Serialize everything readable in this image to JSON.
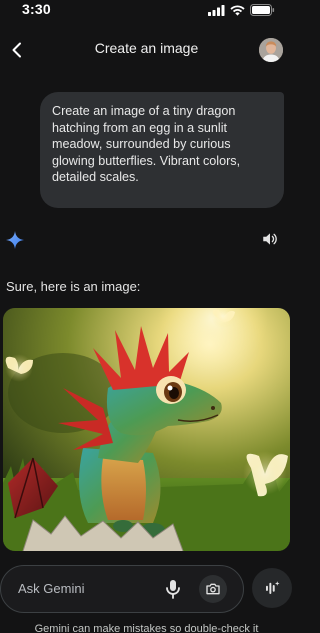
{
  "status_bar": {
    "time": "3:30",
    "icons": [
      "signal-icon",
      "wifi-icon",
      "battery-icon"
    ]
  },
  "header": {
    "back_icon": "back-arrow-icon",
    "title": "Create an image",
    "avatar": "user-avatar"
  },
  "chat": {
    "user_prompt": "Create an image of a tiny dragon hatching from an egg in a sunlit meadow, surrounded by curious glowing butterflies. Vibrant colors, detailed scales.",
    "assistant_icon": "gemini-sparkle-icon",
    "speaker_icon": "speaker-icon",
    "response_text": "Sure, here is an image:",
    "generated_image": "tiny-dragon-hatching-image"
  },
  "input": {
    "placeholder": "Ask Gemini",
    "mic_icon": "mic-icon",
    "camera_icon": "camera-icon",
    "live_icon": "live-audio-icon"
  },
  "footer": {
    "disclaimer": "Gemini can make mistakes so double-check it"
  },
  "colors": {
    "background": "#131314",
    "bubble": "#2e3033",
    "accent_blue": "#4e8df5",
    "text": "#e3e3e3"
  }
}
